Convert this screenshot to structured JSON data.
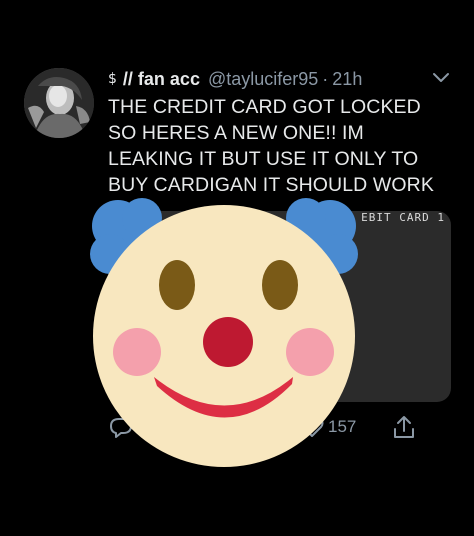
{
  "tweet": {
    "badge_emoji": "$",
    "display_name": "// fan acc",
    "handle": "@taylucifer95",
    "separator": "·",
    "time": "21h",
    "text_lines": [
      "THE CREDIT CARD GOT LOCKED",
      "SO HERES A NEW ONE!! IM",
      "LEAKING IT BUT USE IT ONLY TO",
      "BUY CARDIGAN IT SHOULD WORK"
    ],
    "media_partial_text": "EBIT CARD 1"
  },
  "actions": {
    "like_count": "157"
  },
  "overlay": {
    "emoji_name": "clown-face"
  },
  "colors": {
    "background": "#000000",
    "text": "#e7e9ea",
    "muted": "#8b98a5",
    "media_bg": "#2b2b2b",
    "clown_face": "#f8e7bf",
    "clown_hair": "#4a8bd1",
    "clown_nose": "#be1931",
    "clown_cheek": "#f4a0ac",
    "clown_mouth": "#dd2e44",
    "clown_eyes": "#7a5a17"
  }
}
